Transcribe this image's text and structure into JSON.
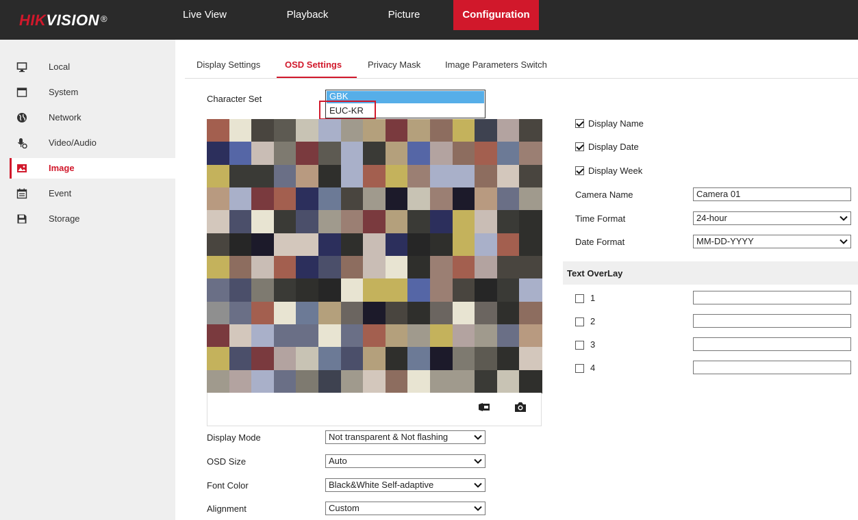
{
  "brand": {
    "logo_red": "HIK",
    "logo_white": "VISION",
    "logo_reg": "®"
  },
  "topnav": [
    {
      "label": "Live View"
    },
    {
      "label": "Playback"
    },
    {
      "label": "Picture"
    },
    {
      "label": "Configuration"
    }
  ],
  "sidebar": {
    "items": [
      {
        "label": "Local",
        "icon": "monitor-icon"
      },
      {
        "label": "System",
        "icon": "window-icon"
      },
      {
        "label": "Network",
        "icon": "globe-icon"
      },
      {
        "label": "Video/Audio",
        "icon": "microphone-icon"
      },
      {
        "label": "Image",
        "icon": "image-icon"
      },
      {
        "label": "Event",
        "icon": "calendar-icon"
      },
      {
        "label": "Storage",
        "icon": "floppy-icon"
      }
    ]
  },
  "tabs": [
    {
      "label": "Display Settings"
    },
    {
      "label": "OSD Settings"
    },
    {
      "label": "Privacy Mask"
    },
    {
      "label": "Image Parameters Switch"
    }
  ],
  "charset": {
    "label": "Character Set",
    "options": [
      "GBK",
      "EUC-KR"
    ]
  },
  "left_fields": {
    "display_mode": {
      "label": "Display Mode",
      "value": "Not transparent & Not flashing"
    },
    "osd_size": {
      "label": "OSD Size",
      "value": "Auto"
    },
    "font_color": {
      "label": "Font Color",
      "value": "Black&White Self-adaptive"
    },
    "alignment": {
      "label": "Alignment",
      "value": "Custom"
    }
  },
  "right": {
    "display_name": {
      "label": "Display Name",
      "checked": true
    },
    "display_date": {
      "label": "Display Date",
      "checked": true
    },
    "display_week": {
      "label": "Display Week",
      "checked": true
    },
    "camera_name": {
      "label": "Camera Name",
      "value": "Camera 01"
    },
    "time_format": {
      "label": "Time Format",
      "value": "24-hour"
    },
    "date_format": {
      "label": "Date Format",
      "value": "MM-DD-YYYY"
    },
    "text_overlay": {
      "title": "Text OverLay",
      "items": [
        {
          "label": "1",
          "checked": false,
          "value": ""
        },
        {
          "label": "2",
          "checked": false,
          "value": ""
        },
        {
          "label": "3",
          "checked": false,
          "value": ""
        },
        {
          "label": "4",
          "checked": false,
          "value": ""
        }
      ]
    }
  },
  "video_controls": [
    {
      "icon": "record-icon"
    },
    {
      "icon": "snapshot-icon"
    }
  ],
  "colors": {
    "accent": "#d1182b",
    "topbar": "#2a2a2a",
    "sidebar": "#efefef",
    "selection": "#56aee8"
  }
}
